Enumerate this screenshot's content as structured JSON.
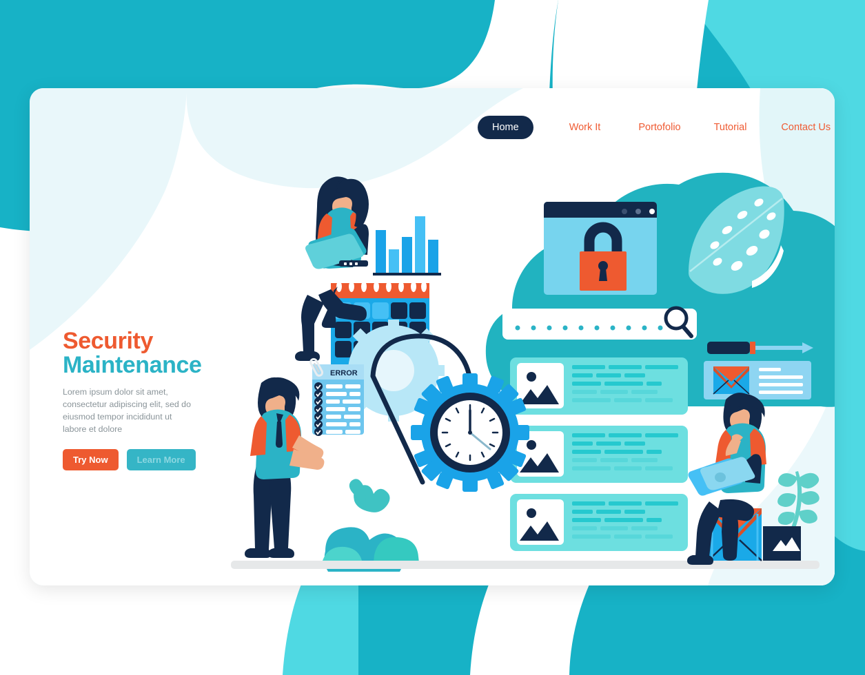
{
  "page": {
    "title": "Security Maintenance",
    "background_color": "#17b2c6",
    "background_color_light": "#4fd9e3",
    "card_background": "#eef9fb"
  },
  "nav": {
    "items": [
      {
        "label": "Home",
        "active": true
      },
      {
        "label": "Work It",
        "active": false
      },
      {
        "label": "Portofolio",
        "active": false
      },
      {
        "label": "Tutorial",
        "active": false
      },
      {
        "label": "Contact Us",
        "active": false
      }
    ],
    "active_bg": "#12294a",
    "link_color": "#ef5b33"
  },
  "hero": {
    "heading_line1": "Security",
    "heading_line2": "Maintenance",
    "heading_color1": "#ee5a30",
    "heading_color2": "#2bb3c6",
    "paragraph": "Lorem ipsum dolor sit amet, consectetur adipiscing elit, sed do eiusmod tempor incididunt ut labore et dolore",
    "primary_button": "Try Now",
    "secondary_button": "Learn More",
    "primary_button_color": "#ee5a30",
    "secondary_button_color": "#35b5c6"
  },
  "illustration": {
    "error_clipboard": {
      "title": "ERROR",
      "checklist_rows": 7,
      "paper_color": "#6ec6ee",
      "title_color": "#12294a"
    },
    "browser_window": {
      "dots": 3,
      "icon": "lock-icon",
      "lock_body_color": "#ee5a30",
      "window_body_color": "#77d4ee",
      "titlebar_color": "#12294a"
    },
    "search_bar": {
      "password_dots": 10,
      "icon": "search-icon",
      "dot_color": "#2bb3c6"
    },
    "content_cards": {
      "count": 3,
      "text_lines_per_card": 5,
      "card_color": "#6ddfe0",
      "thumbnail_icon": "image-placeholder-icon"
    },
    "bar_chart": {
      "bars": 5,
      "heights": [
        62,
        34,
        52,
        82,
        48
      ],
      "colors": [
        "#1aa3e8",
        "#45c0f5",
        "#1aa3e8",
        "#45c0f5",
        "#1aa3e8"
      ]
    },
    "calendar": {
      "columns": 5,
      "rows": 3,
      "binding_rings": 8,
      "header_color": "#ee5a30",
      "body_color": "#1aa9e8",
      "cells": [
        [
          "light",
          "light",
          "light",
          "dark",
          "dark"
        ],
        [
          "dark",
          "dark",
          "dark",
          "dark",
          "dark"
        ],
        [
          "dark",
          "dark",
          "dark",
          "light",
          "light"
        ]
      ]
    },
    "clock_gear": {
      "icon": "clock-icon",
      "gear_color": "#1aa3e8",
      "hour": 12,
      "minute": 20
    },
    "chat_bubble": {
      "icon": "envelope-icon",
      "text_lines": 4,
      "bubble_color": "#8ed5f2"
    },
    "screwdriver": {
      "icon": "screwdriver-icon",
      "handle_color": "#12294a"
    },
    "leaf": {
      "icon": "monstera-leaf-icon",
      "color": "#7fdbe2"
    },
    "people": [
      {
        "name": "woman-with-laptop",
        "shirt_color": "#2bb3c6",
        "sleeve_color": "#ee5a30"
      },
      {
        "name": "man-with-checklist",
        "shirt_color": "#2bb3c6",
        "sleeve_color": "#ee5a30"
      },
      {
        "name": "man-on-envelope-with-laptop",
        "shirt_color": "#2bb3c6",
        "sleeve_color": "#ee5a30"
      }
    ],
    "ground_bar_color": "#e6e8e9"
  }
}
